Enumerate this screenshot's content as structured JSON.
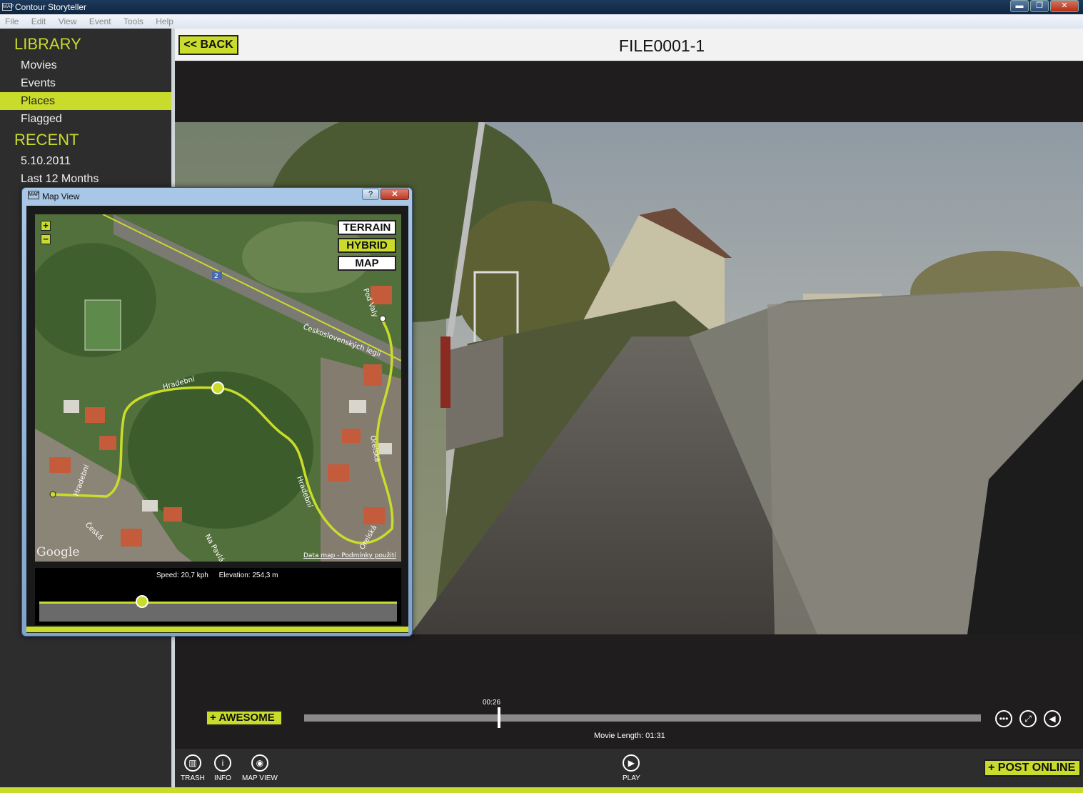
{
  "window": {
    "title": "Contour Storyteller",
    "icon_text": "MAP",
    "minimize": "▬",
    "restore": "❐",
    "close": "✕"
  },
  "menu": [
    "File",
    "Edit",
    "View",
    "Event",
    "Tools",
    "Help"
  ],
  "sidebar": {
    "library_heading": "LIBRARY",
    "library_items": [
      "Movies",
      "Events",
      "Places",
      "Flagged"
    ],
    "active_item": "Places",
    "recent_heading": "RECENT",
    "recent_items": [
      "5.10.2011",
      "Last 12 Months"
    ]
  },
  "topbar": {
    "back_label": "<< BACK",
    "file_title": "FILE0001-1"
  },
  "player": {
    "awesome_label": "+ AWESOME",
    "current_time": "00:26",
    "progress": 0.288,
    "movie_length": "Movie Length: 01:31"
  },
  "toolbar": {
    "trash": "TRASH",
    "info": "INFO",
    "map_view": "MAP VIEW",
    "play": "PLAY",
    "post_online": "+ POST ONLINE"
  },
  "icons": {
    "trash": "trash-icon",
    "info": "info-icon",
    "map": "map-view-icon",
    "play": "play-icon",
    "dots": "more-icon",
    "fullscreen": "fullscreen-icon",
    "volume": "volume-icon"
  },
  "map_window": {
    "title": "Map View",
    "help": "?",
    "close": "✕",
    "zoom_in": "+",
    "zoom_out": "−",
    "map_types": [
      "TERRAIN",
      "HYBRID",
      "MAP"
    ],
    "active_type": "HYBRID",
    "street_labels": [
      "Pod Valy",
      "Československých legií",
      "Hradební",
      "Hradební",
      "Hradební",
      "Orelská",
      "Orelská",
      "Česká",
      "Na Pavláčh"
    ],
    "road_number": "2",
    "google_logo": "Google",
    "attribution": "Data map - Podmínky použití",
    "speed": "Speed: 20,7 kph",
    "elevation": "Elevation: 254,3 m"
  },
  "colors": {
    "accent": "#c9dc2b",
    "background": "#2d2d2d",
    "video_dark": "#1f1d1d"
  }
}
